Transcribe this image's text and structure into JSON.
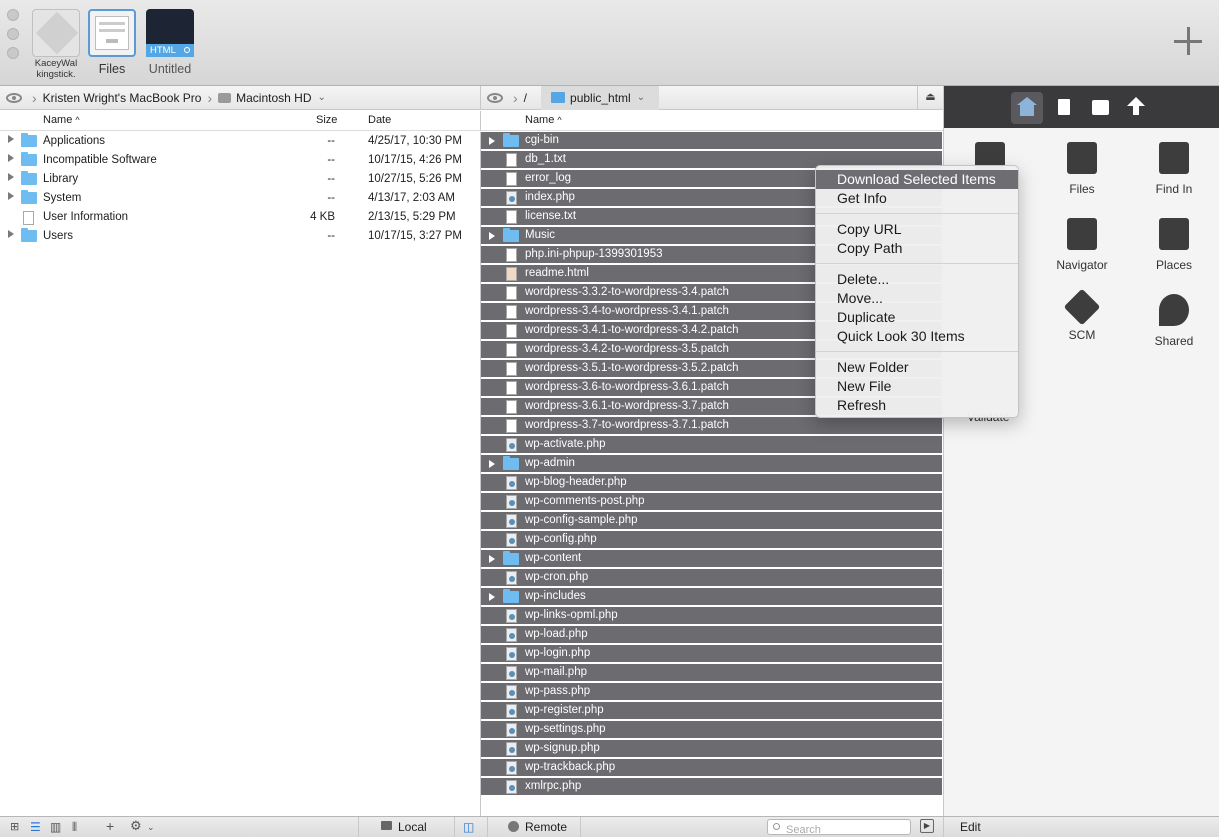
{
  "tabs": [
    {
      "label_line1": "KaceyWal",
      "label_line2": "kingstick."
    },
    {
      "label": "Files"
    },
    {
      "label": "Untitled",
      "badge": "HTML"
    }
  ],
  "local": {
    "breadcrumb": [
      "Kristen Wright's MacBook Pro",
      "Macintosh HD"
    ],
    "columns": {
      "name": "Name",
      "size": "Size",
      "date": "Date"
    },
    "rows": [
      {
        "name": "Applications",
        "size": "--",
        "date": "4/25/17, 10:30 PM",
        "icon": "applications-folder-icon",
        "expandable": true
      },
      {
        "name": "Incompatible Software",
        "size": "--",
        "date": "10/17/15, 4:26 PM",
        "icon": "folder-icon",
        "expandable": true
      },
      {
        "name": "Library",
        "size": "--",
        "date": "10/27/15, 5:26 PM",
        "icon": "library-folder-icon",
        "expandable": true
      },
      {
        "name": "System",
        "size": "--",
        "date": "4/13/17, 2:03 AM",
        "icon": "system-folder-icon",
        "expandable": true
      },
      {
        "name": "User Information",
        "size": "4 KB",
        "date": "2/13/15, 5:29 PM",
        "icon": "document-icon",
        "expandable": false
      },
      {
        "name": "Users",
        "size": "--",
        "date": "10/17/15, 3:27 PM",
        "icon": "users-folder-icon",
        "expandable": true
      }
    ]
  },
  "remote": {
    "root": "/",
    "folder": "public_html",
    "columns": {
      "name": "Name"
    },
    "rows": [
      {
        "name": "cgi-bin",
        "type": "folder"
      },
      {
        "name": "db_1.txt",
        "type": "file"
      },
      {
        "name": "error_log",
        "type": "file"
      },
      {
        "name": "index.php",
        "type": "php"
      },
      {
        "name": "license.txt",
        "type": "file"
      },
      {
        "name": "Music",
        "type": "folder"
      },
      {
        "name": "php.ini-phpup-1399301953",
        "type": "file"
      },
      {
        "name": "readme.html",
        "type": "html"
      },
      {
        "name": "wordpress-3.3.2-to-wordpress-3.4.patch",
        "type": "file"
      },
      {
        "name": "wordpress-3.4-to-wordpress-3.4.1.patch",
        "type": "file"
      },
      {
        "name": "wordpress-3.4.1-to-wordpress-3.4.2.patch",
        "type": "file"
      },
      {
        "name": "wordpress-3.4.2-to-wordpress-3.5.patch",
        "type": "file"
      },
      {
        "name": "wordpress-3.5.1-to-wordpress-3.5.2.patch",
        "type": "file"
      },
      {
        "name": "wordpress-3.6-to-wordpress-3.6.1.patch",
        "type": "file"
      },
      {
        "name": "wordpress-3.6.1-to-wordpress-3.7.patch",
        "type": "file"
      },
      {
        "name": "wordpress-3.7-to-wordpress-3.7.1.patch",
        "type": "file"
      },
      {
        "name": "wp-activate.php",
        "type": "php"
      },
      {
        "name": "wp-admin",
        "type": "folder"
      },
      {
        "name": "wp-blog-header.php",
        "type": "php"
      },
      {
        "name": "wp-comments-post.php",
        "type": "php"
      },
      {
        "name": "wp-config-sample.php",
        "type": "php"
      },
      {
        "name": "wp-config.php",
        "type": "php"
      },
      {
        "name": "wp-content",
        "type": "folder"
      },
      {
        "name": "wp-cron.php",
        "type": "php"
      },
      {
        "name": "wp-includes",
        "type": "folder"
      },
      {
        "name": "wp-links-opml.php",
        "type": "php"
      },
      {
        "name": "wp-load.php",
        "type": "php"
      },
      {
        "name": "wp-login.php",
        "type": "php"
      },
      {
        "name": "wp-mail.php",
        "type": "php"
      },
      {
        "name": "wp-pass.php",
        "type": "php"
      },
      {
        "name": "wp-register.php",
        "type": "php"
      },
      {
        "name": "wp-settings.php",
        "type": "php"
      },
      {
        "name": "wp-signup.php",
        "type": "php"
      },
      {
        "name": "wp-trackback.php",
        "type": "php"
      },
      {
        "name": "xmlrpc.php",
        "type": "php"
      }
    ]
  },
  "context_menu": {
    "groups": [
      [
        "Download Selected Items",
        "Get Info"
      ],
      [
        "Copy URL",
        "Copy Path"
      ],
      [
        "Delete...",
        "Move...",
        "Duplicate",
        "Quick Look 30 Items"
      ],
      [
        "New Folder",
        "New File",
        "Refresh"
      ]
    ],
    "highlighted": "Download Selected Items"
  },
  "sidebar": {
    "tiles": [
      {
        "label": "",
        "icon": "snippets-icon"
      },
      {
        "label": "Files",
        "icon": "files-icon"
      },
      {
        "label": "Find In",
        "icon": "find-in-icon"
      },
      {
        "label": "",
        "icon": "hidden-icon"
      },
      {
        "label": "Navigator",
        "icon": "navigator-icon"
      },
      {
        "label": "Places",
        "icon": "places-icon"
      },
      {
        "label": "",
        "icon": "hidden-icon"
      },
      {
        "label": "SCM",
        "icon": "scm-icon"
      },
      {
        "label": "Shared",
        "icon": "shared-icon"
      }
    ],
    "partial_label": "Validate",
    "edit_label": "Edit"
  },
  "status": {
    "local": "Local",
    "remote": "Remote",
    "search_placeholder": "Search"
  },
  "colors": {
    "selection_row": "#6b6b70",
    "sidebar_header": "#3a3a3c",
    "folder_blue": "#6fbcf0"
  }
}
